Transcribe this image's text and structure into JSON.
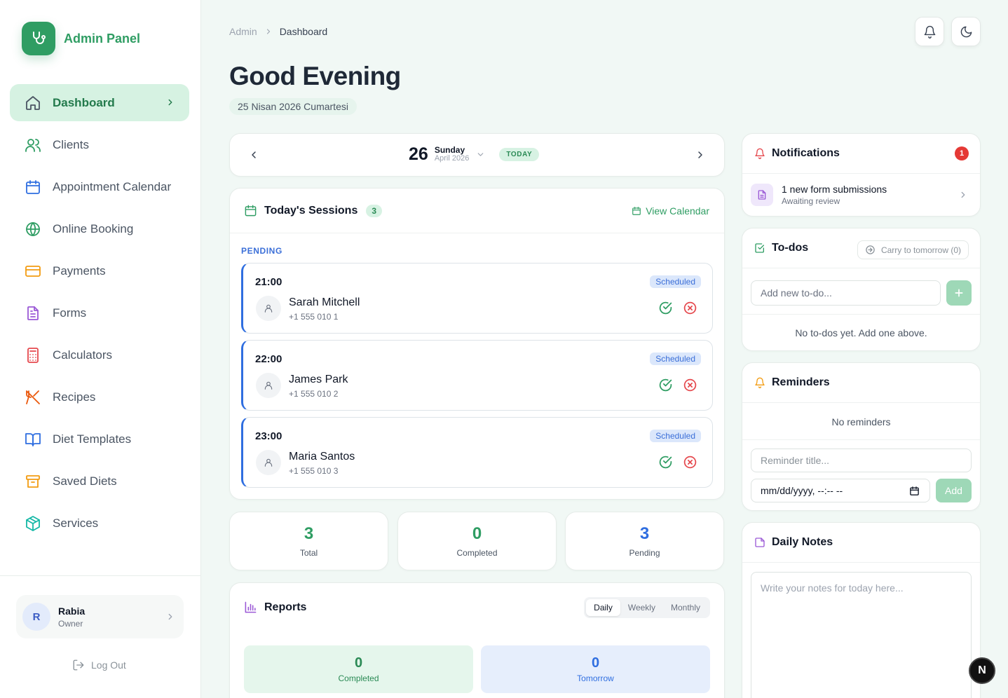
{
  "brand": {
    "title": "Admin Panel"
  },
  "sidebar": {
    "items": [
      {
        "label": "Dashboard",
        "icon": "home-icon",
        "active": true
      },
      {
        "label": "Clients",
        "icon": "users-icon"
      },
      {
        "label": "Appointment Calendar",
        "icon": "calendar-icon"
      },
      {
        "label": "Online Booking",
        "icon": "globe-icon"
      },
      {
        "label": "Payments",
        "icon": "credit-card-icon"
      },
      {
        "label": "Forms",
        "icon": "file-text-icon"
      },
      {
        "label": "Calculators",
        "icon": "calculator-icon"
      },
      {
        "label": "Recipes",
        "icon": "utensils-icon"
      },
      {
        "label": "Diet Templates",
        "icon": "book-open-icon"
      },
      {
        "label": "Saved Diets",
        "icon": "archive-icon"
      },
      {
        "label": "Services",
        "icon": "package-icon"
      }
    ],
    "user": {
      "initial": "R",
      "name": "Rabia",
      "role": "Owner"
    },
    "logout": "Log Out"
  },
  "header": {
    "breadcrumb": {
      "root": "Admin",
      "current": "Dashboard"
    },
    "greeting": "Good Evening",
    "date": "25 Nisan 2026 Cumartesi"
  },
  "date_nav": {
    "day": "26",
    "weekday": "Sunday",
    "month_year": "April 2026",
    "badge": "TODAY"
  },
  "sessions": {
    "title": "Today's Sessions",
    "count": "3",
    "view_calendar": "View Calendar",
    "group_label": "PENDING",
    "items": [
      {
        "time": "21:00",
        "status": "Scheduled",
        "name": "Sarah Mitchell",
        "phone": "+1 555 010 1"
      },
      {
        "time": "22:00",
        "status": "Scheduled",
        "name": "James Park",
        "phone": "+1 555 010 2"
      },
      {
        "time": "23:00",
        "status": "Scheduled",
        "name": "Maria Santos",
        "phone": "+1 555 010 3"
      }
    ]
  },
  "stats": [
    {
      "value": "3",
      "label": "Total",
      "color": "#2f9d63"
    },
    {
      "value": "0",
      "label": "Completed",
      "color": "#2f9d63"
    },
    {
      "value": "3",
      "label": "Pending",
      "color": "#2f6ee0"
    }
  ],
  "reports": {
    "title": "Reports",
    "tabs": [
      "Daily",
      "Weekly",
      "Monthly"
    ],
    "active_tab": "Daily",
    "boxes": [
      {
        "value": "0",
        "label": "Completed"
      },
      {
        "value": "0",
        "label": "Tomorrow"
      }
    ]
  },
  "notifications": {
    "title": "Notifications",
    "count": "1",
    "items": [
      {
        "title": "1 new form submissions",
        "subtitle": "Awaiting review"
      }
    ]
  },
  "todos": {
    "title": "To-dos",
    "carry_label": "Carry to tomorrow (0)",
    "placeholder": "Add new to-do...",
    "empty": "No to-dos yet. Add one above."
  },
  "reminders": {
    "title": "Reminders",
    "empty": "No reminders",
    "title_placeholder": "Reminder title...",
    "date_placeholder": "mm/dd/yyyy, --:-- --",
    "add_label": "Add"
  },
  "notes": {
    "title": "Daily Notes",
    "placeholder": "Write your notes for today here..."
  },
  "dev_badge": "N",
  "colors": {
    "accent": "#2f9d63",
    "blue": "#2f6ee0",
    "danger": "#e53935"
  }
}
